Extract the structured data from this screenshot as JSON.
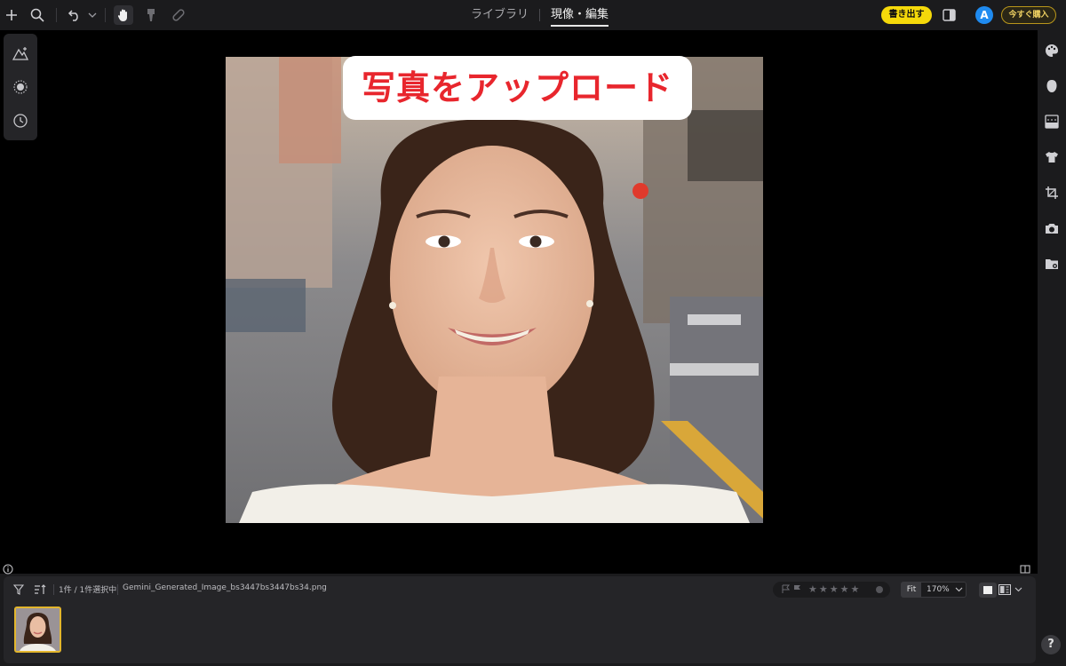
{
  "topbar": {
    "tabs": [
      {
        "label": "ライブラリ",
        "active": false
      },
      {
        "label": "現像・編集",
        "active": true
      }
    ],
    "export_label": "書き出す",
    "avatar_letter": "A",
    "buy_label": "今すぐ購入",
    "icons": [
      "plus-icon",
      "search-icon",
      "undo-icon",
      "chevron-down-icon",
      "hand-icon",
      "brush-icon",
      "bandage-icon",
      "panel-toggle-icon"
    ]
  },
  "left_tools": [
    "auto-enhance-icon",
    "radial-icon",
    "history-icon"
  ],
  "canvas": {
    "banner_text": "写真をアップロード",
    "banner_color": "#e8262d"
  },
  "right_rail": [
    "palette-icon",
    "face-icon",
    "gradient-icon",
    "shirt-icon",
    "crop-icon",
    "camera-icon",
    "folder-settings-icon"
  ],
  "bottom_bar": {
    "count_text": "1件 / 1件選択中",
    "filename": "Gemini_Generated_Image_bs3447bs3447bs34.png",
    "rating_stars": 0,
    "fit_label": "Fit",
    "zoom": "170%"
  },
  "help_label": "?",
  "colors": {
    "accent_yellow": "#f5d90a",
    "avatar_blue": "#1f8bf0",
    "selection_border": "#e3b62d"
  }
}
